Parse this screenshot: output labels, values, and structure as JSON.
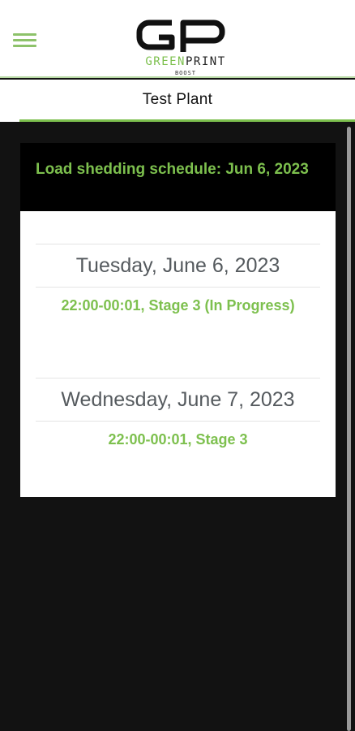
{
  "header": {
    "brand_green": "GREEN",
    "brand_dark": "PRINT",
    "brand_sub": "BOOST"
  },
  "plant": {
    "title": "Test Plant"
  },
  "schedule": {
    "title": "Load shedding schedule: Jun 6, 2023",
    "days": [
      {
        "date": "Tuesday, June 6, 2023",
        "slot": "22:00-00:01, Stage 3 (In Progress)"
      },
      {
        "date": "Wednesday, June 7, 2023",
        "slot": "22:00-00:01, Stage 3"
      }
    ]
  },
  "colors": {
    "accent": "#7dc04e",
    "background": "#121212",
    "header": "#ffffff",
    "card_header": "#000000"
  },
  "icons": [
    "hamburger-menu-icon",
    "greenprint-logo"
  ]
}
